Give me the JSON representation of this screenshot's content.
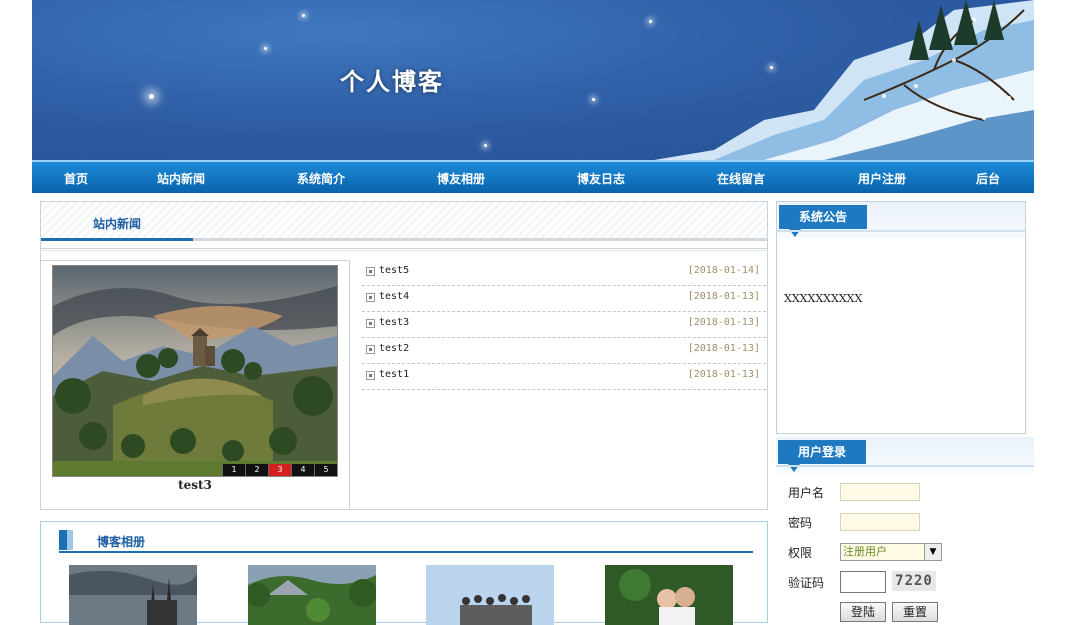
{
  "site": {
    "title": "个人博客"
  },
  "nav": {
    "items": [
      {
        "label": "首页"
      },
      {
        "label": "站内新闻"
      },
      {
        "label": "系统简介"
      },
      {
        "label": "博友相册"
      },
      {
        "label": "博友日志"
      },
      {
        "label": "在线留言"
      },
      {
        "label": "用户注册"
      },
      {
        "label": "后台"
      }
    ]
  },
  "news": {
    "section_title": "站内新闻",
    "slideshow": {
      "caption": "test3",
      "numbers": [
        "1",
        "2",
        "3",
        "4",
        "5"
      ],
      "active": "3"
    },
    "items": [
      {
        "title": "test5",
        "date": "[2018-01-14]"
      },
      {
        "title": "test4",
        "date": "[2018-01-13]"
      },
      {
        "title": "test3",
        "date": "[2018-01-13]"
      },
      {
        "title": "test2",
        "date": "[2018-01-13]"
      },
      {
        "title": "test1",
        "date": "[2018-01-13]"
      }
    ]
  },
  "album": {
    "section_title": "博客相册"
  },
  "notice": {
    "title": "系统公告",
    "content": "XXXXXXXXXX"
  },
  "login": {
    "title": "用户登录",
    "username_label": "用户名",
    "password_label": "密码",
    "role_label": "权限",
    "role_value": "注册用户",
    "captcha_label": "验证码",
    "captcha_text": "7220",
    "login_button": "登陆",
    "reset_button": "重置"
  }
}
